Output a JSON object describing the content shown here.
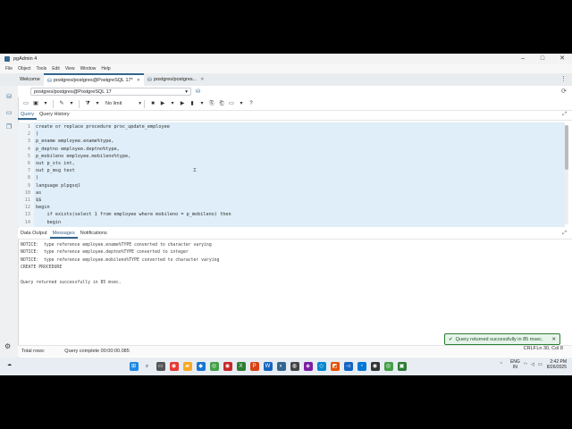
{
  "window": {
    "title": "pgAdmin 4"
  },
  "menu": [
    "File",
    "Object",
    "Tools",
    "Edit",
    "View",
    "Window",
    "Help"
  ],
  "tabs": [
    {
      "label": "Welcome"
    },
    {
      "label": "postgres/postgres@PostgreSQL 17*"
    },
    {
      "label": "postgres/postgres..."
    }
  ],
  "connection": {
    "value": "postgres/postgres@PostgreSQL 17"
  },
  "toolbar": {
    "limit": "No limit"
  },
  "query_tabs": {
    "query": "Query",
    "history": "Query History"
  },
  "editor": {
    "lines": [
      {
        "n": "1",
        "text": "create or replace procedure proc_update_employee"
      },
      {
        "n": "2",
        "text": "("
      },
      {
        "n": "3",
        "text": "p_ename employee.ename%type,"
      },
      {
        "n": "4",
        "text": "p_deptno employee.deptno%type,"
      },
      {
        "n": "5",
        "text": "p_mobileno employee.mobileno%type,"
      },
      {
        "n": "6",
        "text": "out p_sts int,"
      },
      {
        "n": "7",
        "text": "out p_msg text"
      },
      {
        "n": "8",
        "text": ")"
      },
      {
        "n": "9",
        "text": "language plpgsql"
      },
      {
        "n": "10",
        "text": "as"
      },
      {
        "n": "11",
        "text": "$$"
      },
      {
        "n": "12",
        "text": "begin"
      },
      {
        "n": "13",
        "text": "    if exists(select 1 from employee where mobileno = p_mobileno) then"
      },
      {
        "n": "14",
        "text": "    begin"
      }
    ]
  },
  "result_tabs": {
    "output": "Data Output",
    "messages": "Messages",
    "notifications": "Notifications"
  },
  "messages": [
    "NOTICE:  type reference employee.ename%TYPE converted to character varying",
    "NOTICE:  type reference employee.deptno%TYPE converted to integer",
    "NOTICE:  type reference employee.mobileno%TYPE converted to character varying",
    "CREATE PROCEDURE",
    "",
    "Query returned successfully in 85 msec."
  ],
  "status": {
    "total_rows": "Total rows:",
    "query_complete": "Query complete 00:00:00.085",
    "crlf": "CRLF",
    "position": "Ln 30, Col 8"
  },
  "toast": {
    "text": "Query returned successfully in 85 msec."
  },
  "taskbar": {
    "lang": "ENG",
    "region": "IN",
    "time": "2:42 PM",
    "date": "8/26/2025"
  }
}
